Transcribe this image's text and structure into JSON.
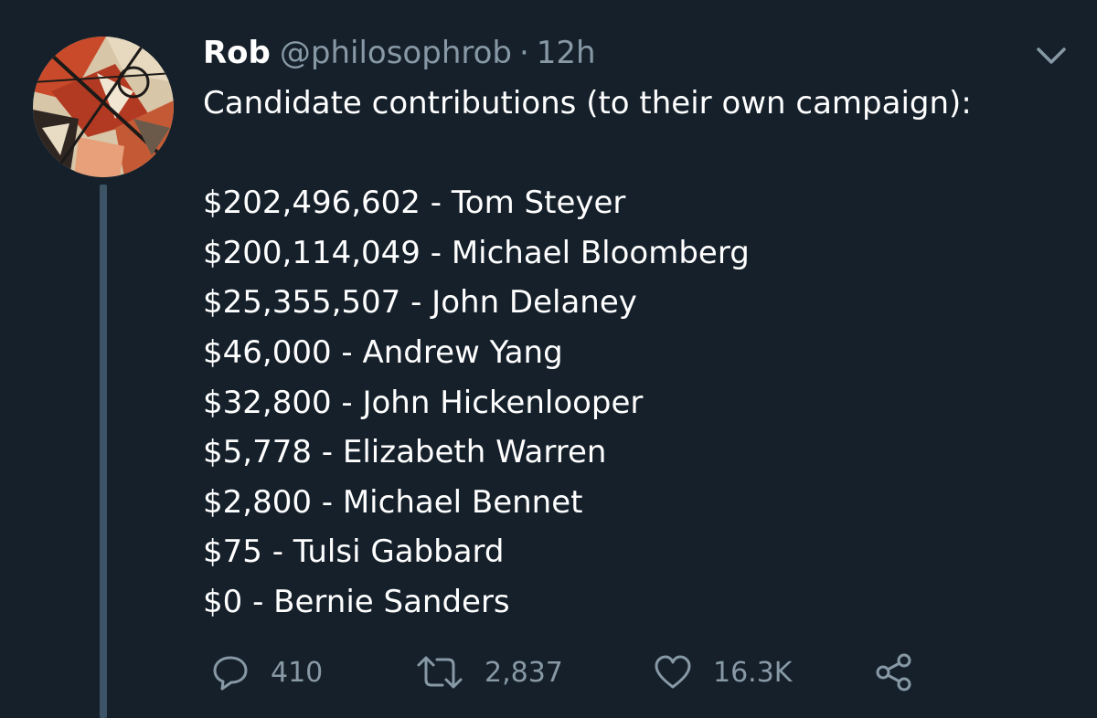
{
  "tweet": {
    "author": {
      "name": "Rob",
      "handle": "@philosophrob",
      "separator": "·",
      "time": "12h",
      "avatar_icon": "abstract-art-avatar"
    },
    "text": {
      "intro": "Candidate contributions (to their own campaign):",
      "lines": [
        "$202,496,602 - Tom Steyer",
        "$200,114,049 - Michael Bloomberg",
        "$25,355,507 - John Delaney",
        "$46,000 - Andrew Yang",
        "$32,800 - John Hickenlooper",
        "$5,778 - Elizabeth Warren",
        "$2,800 - Michael Bennet",
        "$75 - Tulsi Gabbard",
        "$0 - Bernie Sanders"
      ]
    },
    "actions": {
      "reply": {
        "icon": "reply-icon",
        "count": "410"
      },
      "retweet": {
        "icon": "retweet-icon",
        "count": "2,837"
      },
      "like": {
        "icon": "heart-icon",
        "count": "16.3K"
      },
      "share": {
        "icon": "share-icon"
      }
    },
    "menu_icon": "chevron-down-icon"
  },
  "colors": {
    "background": "#15202b",
    "text_primary": "#ffffff",
    "text_secondary": "#8899a6",
    "thread_line": "#3d5466"
  }
}
